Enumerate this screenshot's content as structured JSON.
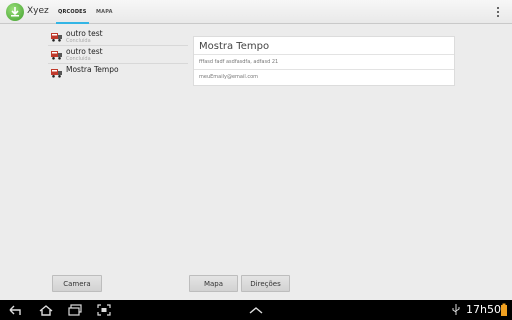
{
  "app": {
    "title": "Xyez",
    "icon": "app-download-icon",
    "accent": "#33b5e5"
  },
  "tabs": [
    {
      "label": "QRCODES",
      "active": true
    },
    {
      "label": "MAPA",
      "active": false
    }
  ],
  "list": {
    "items": [
      {
        "title": "outro test",
        "subtitle": "Concluída",
        "icon": "truck-icon"
      },
      {
        "title": "outro test",
        "subtitle": "Concluída",
        "icon": "truck-icon"
      },
      {
        "title": "Mostra Tempo",
        "subtitle": "",
        "icon": "truck-icon"
      }
    ]
  },
  "detail": {
    "title": "Mostra Tempo",
    "text": "fffasd fadf asdfasdfa, adfasd 21",
    "email": "meuEmaily@email.com"
  },
  "buttons": {
    "camera": "Camera",
    "mapa": "Mapa",
    "direcoes": "Direções"
  },
  "system": {
    "time": "17h50"
  }
}
